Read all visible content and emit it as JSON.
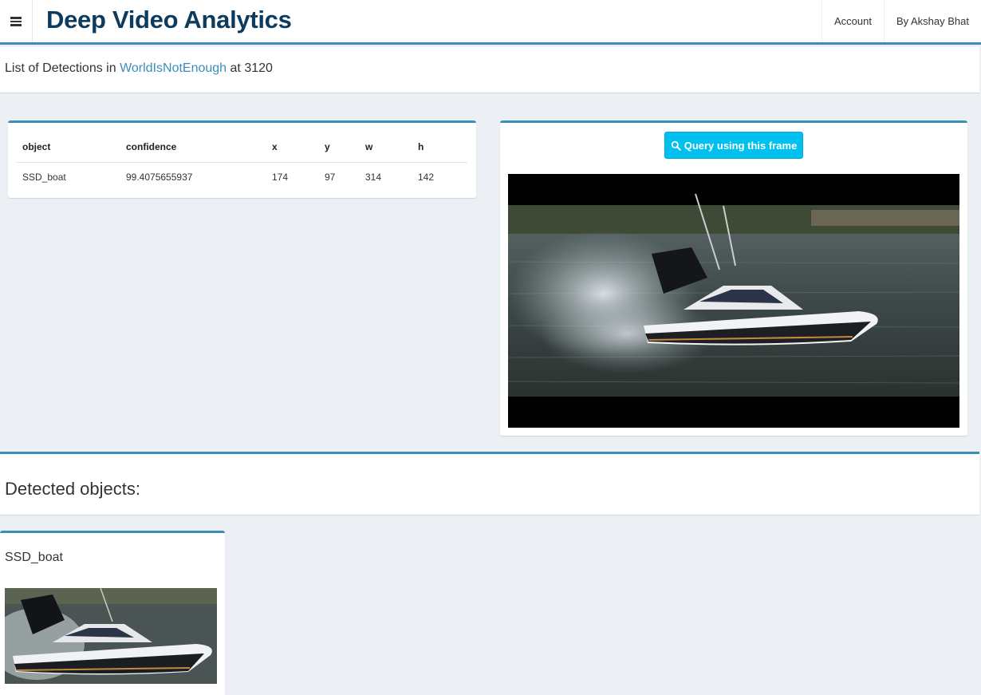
{
  "header": {
    "brand": "Deep Video Analytics",
    "nav": [
      "Account",
      "By Akshay Bhat"
    ]
  },
  "title": {
    "prefix": "List of Detections in ",
    "video_link": "WorldIsNotEnough",
    "suffix": " at 3120"
  },
  "detections_table": {
    "columns": [
      "object",
      "confidence",
      "x",
      "y",
      "w",
      "h"
    ],
    "rows": [
      [
        "SSD_boat",
        "99.4075655937",
        "174",
        "97",
        "314",
        "142"
      ]
    ]
  },
  "frame_panel": {
    "query_button_label": "Query using this frame",
    "query_icon": "search-icon"
  },
  "detected_section": {
    "title": "Detected objects:",
    "items": [
      {
        "label": "SSD_boat"
      }
    ]
  },
  "colors": {
    "accent": "#3c8dbc",
    "brand": "#0d3b5e",
    "button": "#00c0ef",
    "background": "#ecf0f5"
  }
}
